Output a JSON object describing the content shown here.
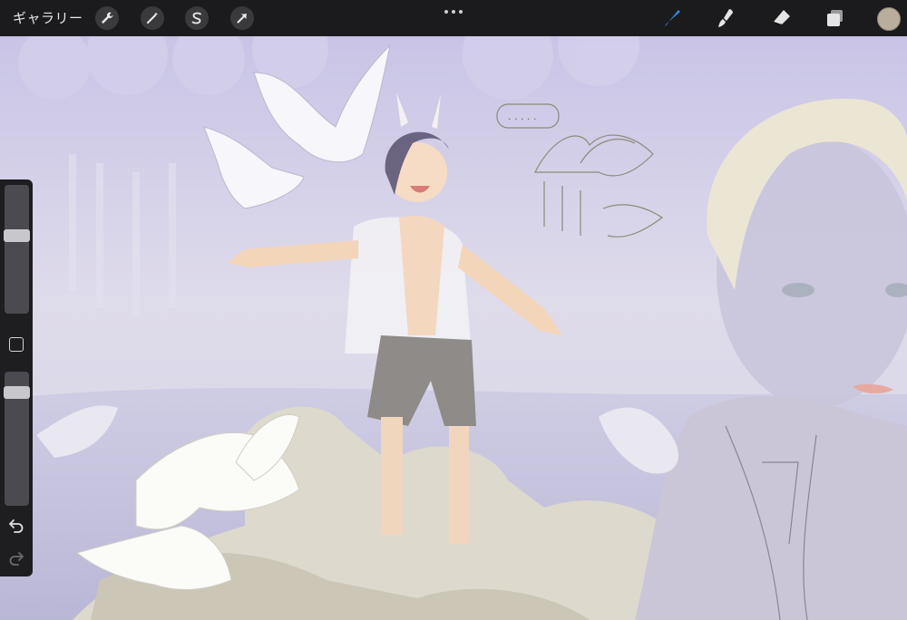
{
  "toolbar": {
    "gallery_label": "ギャラリー",
    "left_tools": [
      {
        "icon": "wrench-icon"
      },
      {
        "icon": "magic-wand-icon"
      },
      {
        "icon": "selection-s-icon"
      },
      {
        "icon": "transform-arrow-icon"
      }
    ],
    "more_icon": "more-dots-icon",
    "right_tools": [
      {
        "icon": "brush-icon",
        "active": true,
        "color": "#3a7bd5"
      },
      {
        "icon": "smudge-icon"
      },
      {
        "icon": "eraser-icon"
      },
      {
        "icon": "layers-icon"
      }
    ],
    "current_color": "#b9ad9d"
  },
  "sidebar": {
    "brush_size_level": 0.62,
    "opacity_level": 0.12,
    "modifier_icon": "modifier-square-icon",
    "undo_icon": "undo-icon",
    "redo_icon": "redo-icon"
  },
  "canvas": {
    "speech_bubble_text": ". . . . ."
  }
}
